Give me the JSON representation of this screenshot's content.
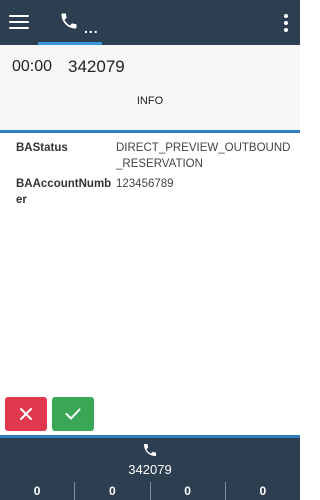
{
  "topbar": {
    "menu_icon": "hamburger-menu-icon",
    "call_tab_icon": "phone-icon",
    "call_tab_more": "...",
    "overflow_icon": "vertical-dots-icon",
    "accent": "#3498db"
  },
  "call": {
    "timer": "00:00",
    "number": "342079"
  },
  "tabs": {
    "info": "INFO"
  },
  "fields": [
    {
      "label": "BAStatus",
      "value": "DIRECT_PREVIEW_OUTBOUND_RESERVATION"
    },
    {
      "label": "BAAccountNumber",
      "value": "123456789"
    }
  ],
  "actions": {
    "reject_icon": "close-icon",
    "accept_icon": "check-icon",
    "reject_color": "#e0394f",
    "accept_color": "#3aa757"
  },
  "bottom": {
    "phone_icon": "phone-icon",
    "number": "342079",
    "counters": [
      "0",
      "0",
      "0",
      "0"
    ]
  }
}
